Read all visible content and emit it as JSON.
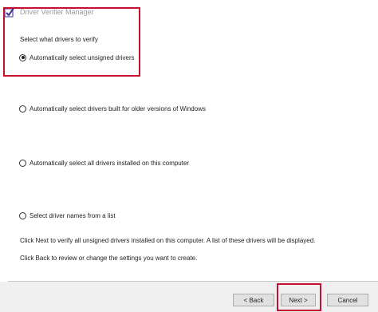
{
  "window": {
    "title": "Driver Verifier Manager"
  },
  "group": {
    "label": "Select what drivers to verify"
  },
  "options": [
    {
      "label": "Automatically select unsigned drivers",
      "checked": true
    },
    {
      "label": "Automatically select drivers built for older versions of Windows",
      "checked": false
    },
    {
      "label": "Automatically select all drivers installed on this computer",
      "checked": false
    },
    {
      "label": "Select driver names from a list",
      "checked": false
    }
  ],
  "info": {
    "line1": "Click Next to verify all unsigned drivers installed on this computer. A list of these drivers will be displayed.",
    "line2": "Click Back to review or change the settings you want to create."
  },
  "buttons": {
    "back": "< Back",
    "next": "Next >",
    "cancel": "Cancel"
  },
  "colors": {
    "highlight": "#c8102e"
  }
}
